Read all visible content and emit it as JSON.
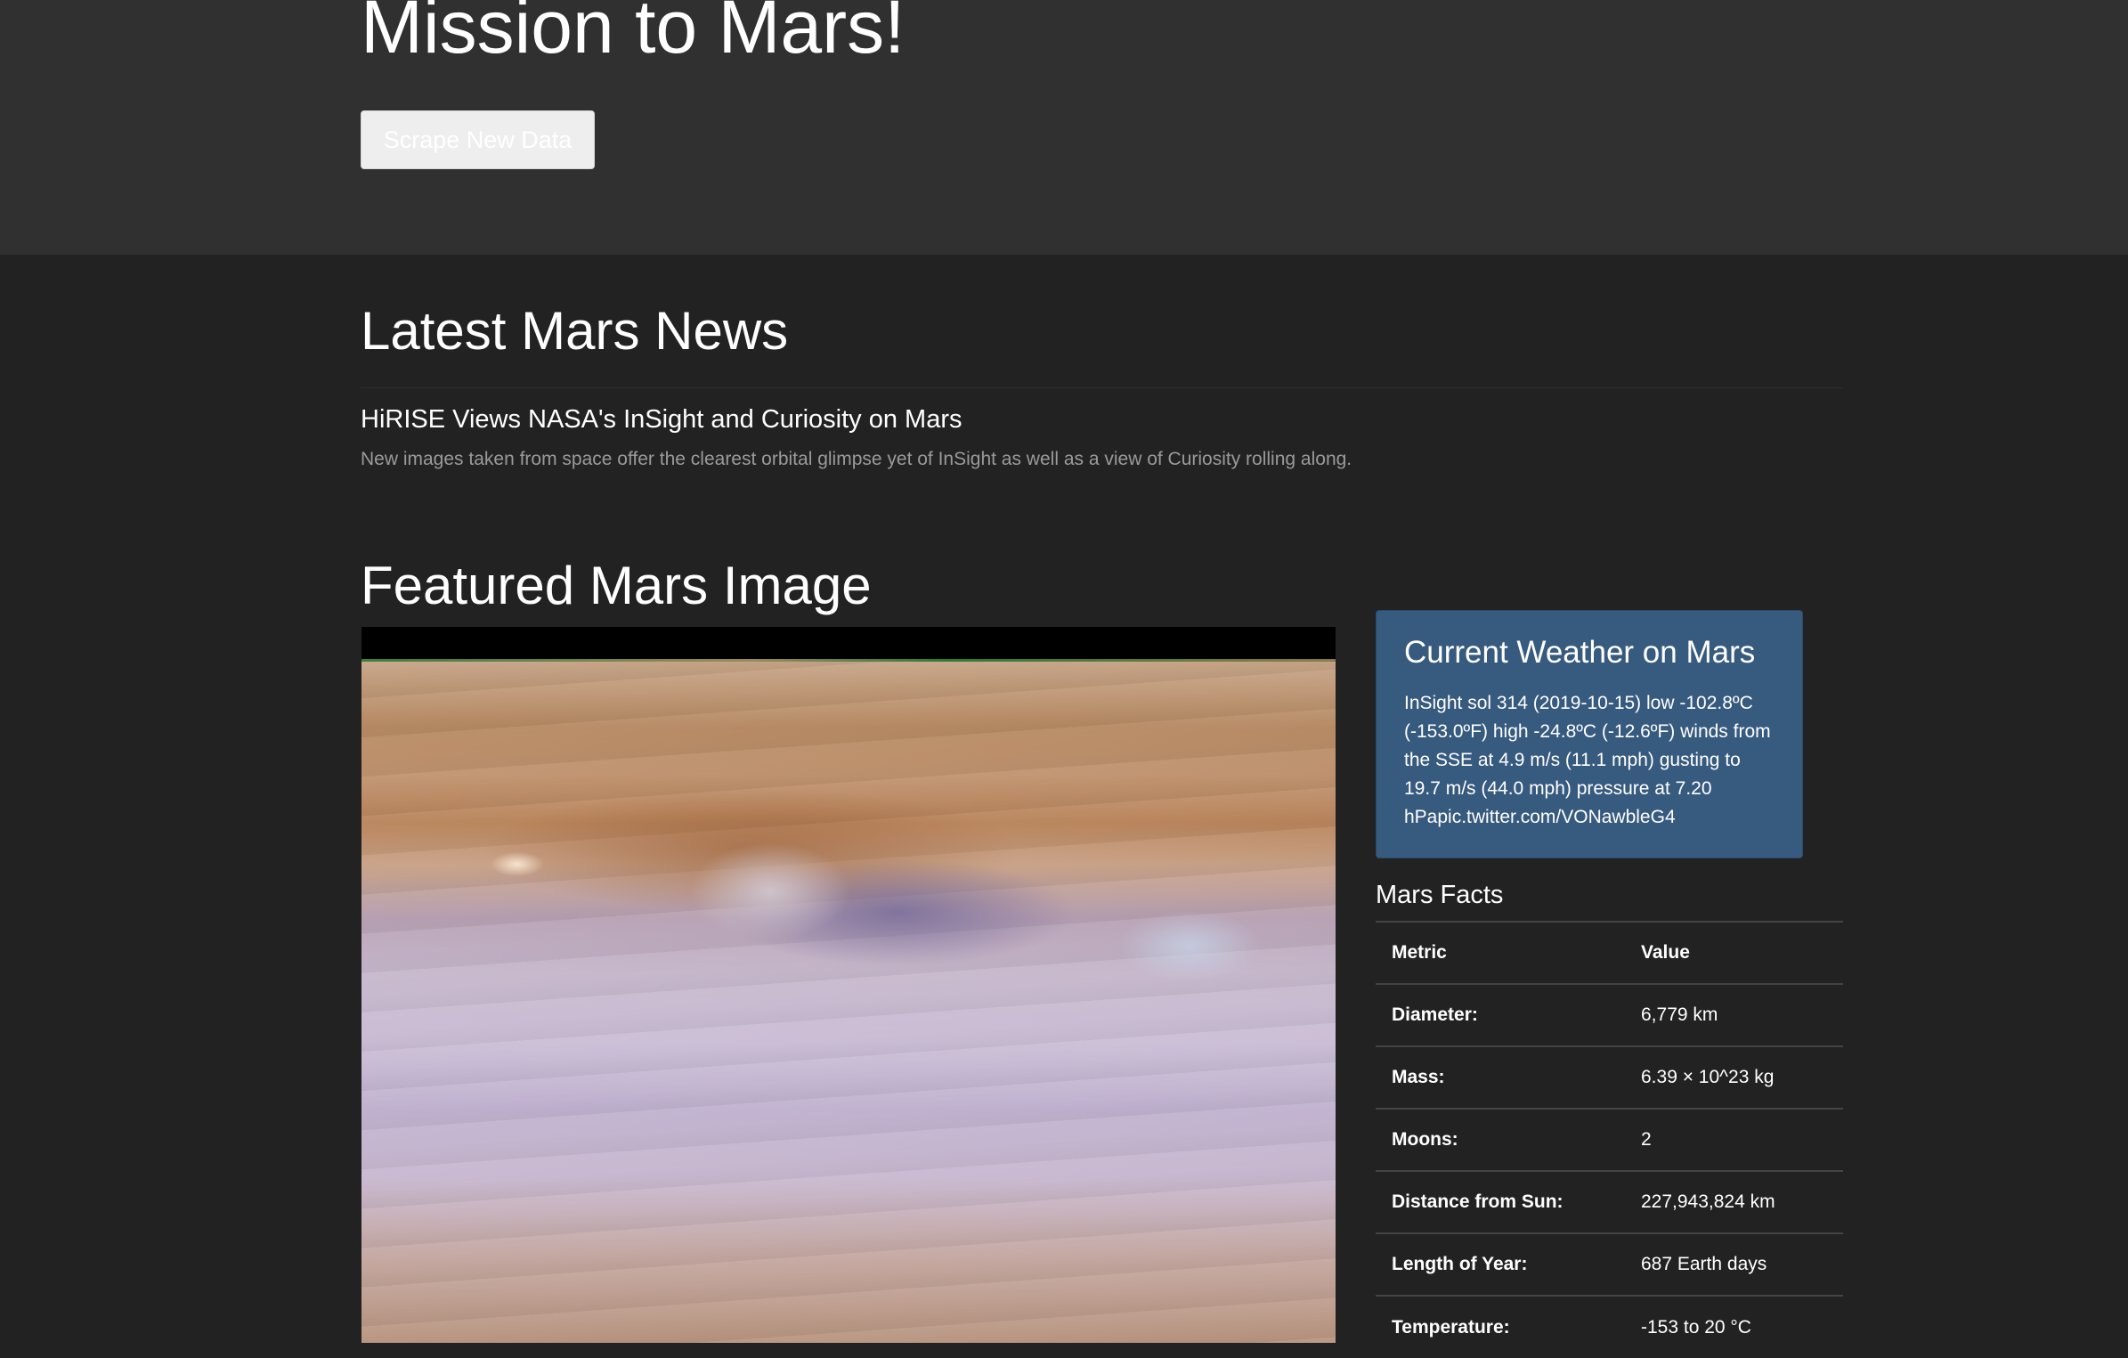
{
  "header": {
    "title": "Mission to Mars!",
    "scrape_button_label": "Scrape New Data"
  },
  "news": {
    "section_title": "Latest Mars News",
    "headline": "HiRISE Views NASA's InSight and Curiosity on Mars",
    "teaser": "New images taken from space offer the clearest orbital glimpse yet of InSight as well as a view of Curiosity rolling along."
  },
  "featured": {
    "section_title": "Featured Mars Image"
  },
  "weather": {
    "title": "Current Weather on Mars",
    "text": "InSight sol 314 (2019-10-15) low -102.8ºC (-153.0ºF) high -24.8ºC (-12.6ºF) winds from the SSE at 4.9 m/s (11.1 mph) gusting to 19.7 m/s (44.0 mph) pressure at 7.20 hPapic.twitter.com/VONawbleG4"
  },
  "facts": {
    "title": "Mars Facts",
    "headers": {
      "metric": "Metric",
      "value": "Value"
    },
    "rows": [
      {
        "metric": "Diameter:",
        "value": "6,779 km"
      },
      {
        "metric": "Mass:",
        "value": "6.39 × 10^23 kg"
      },
      {
        "metric": "Moons:",
        "value": "2"
      },
      {
        "metric": "Distance from Sun:",
        "value": "227,943,824 km"
      },
      {
        "metric": "Length of Year:",
        "value": "687 Earth days"
      },
      {
        "metric": "Temperature:",
        "value": "-153 to 20 °C"
      }
    ]
  }
}
